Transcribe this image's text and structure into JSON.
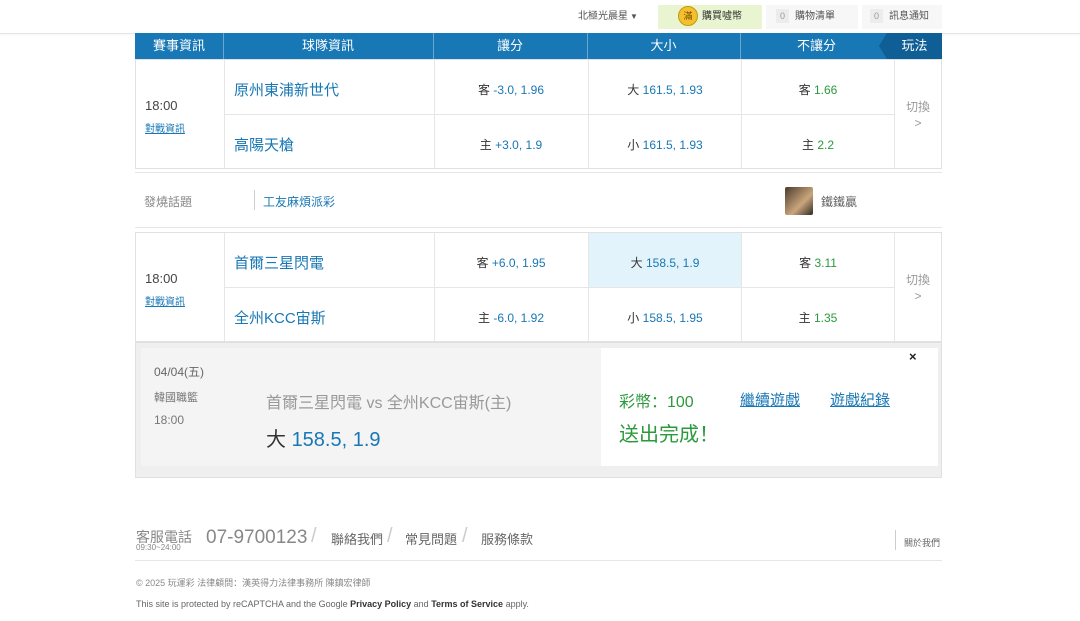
{
  "topbar": {
    "user": "北極光晨星",
    "buy_coin_icon": "滿",
    "buy_label": "購買噓幣",
    "cart_count": "0",
    "cart_label": "購物清單",
    "notify_count": "0",
    "notify_label": "訊息通知"
  },
  "table_header": {
    "col_info": "賽事資訊",
    "col_team": "球隊資訊",
    "col_spread": "讓分",
    "col_total": "大小",
    "col_moneyline": "不讓分",
    "col_play": "玩法"
  },
  "games": [
    {
      "time": "18:00",
      "vs_link": "對戰資訊",
      "away_team": "原州東浦新世代",
      "home_team": "高陽天槍",
      "spread_away_prefix": "客",
      "spread_away_value": "-3.0, 1.96",
      "spread_home_prefix": "主",
      "spread_home_value": "+3.0, 1.9",
      "total_over_prefix": "大",
      "total_over_value": "161.5, 1.93",
      "total_under_prefix": "小",
      "total_under_value": "161.5, 1.93",
      "ml_away_prefix": "客",
      "ml_away_value": "1.66",
      "ml_home_prefix": "主",
      "ml_home_value": "2.2",
      "switch_label": "切換",
      "switch_arrow": ">"
    },
    {
      "time": "18:00",
      "vs_link": "對戰資訊",
      "away_team": "首爾三星閃電",
      "home_team": "全州KCC宙斯",
      "spread_away_prefix": "客",
      "spread_away_value": "+6.0, 1.95",
      "spread_home_prefix": "主",
      "spread_home_value": "-6.0, 1.92",
      "total_over_prefix": "大",
      "total_over_value": "158.5, 1.9",
      "total_under_prefix": "小",
      "total_under_value": "158.5, 1.95",
      "ml_away_prefix": "客",
      "ml_away_value": "3.11",
      "ml_home_prefix": "主",
      "ml_home_value": "1.35",
      "switch_label": "切換",
      "switch_arrow": ">"
    }
  ],
  "topic": {
    "label": "發燒話題",
    "text": "工友麻煩派彩",
    "user": "鐵鐵贏"
  },
  "result": {
    "date": "04/04(五)",
    "league": "韓國職籃",
    "time": "18:00",
    "match": "首爾三星閃電 vs 全州KCC宙斯(主)",
    "bet_prefix": "大",
    "bet_value": "158.5, 1.9",
    "coin_text": "彩幣：100",
    "done_text": "送出完成！",
    "continue_link": "繼續遊戲",
    "record_link": "遊戲紀錄",
    "close": "×"
  },
  "footer": {
    "phone_label": "客服電話",
    "phone_hours": "09:30~24:00",
    "phone_number": "07-9700123",
    "link_contact": "聯絡我們",
    "link_faq": "常見問題",
    "link_terms": "服務條款",
    "link_about": "關於我們",
    "copyright": "© 2025 玩運彩 法律顧問：漢英得力法律事務所 陳鎮宏律師",
    "recaptcha_pre": "This site is protected by reCAPTCHA and the Google ",
    "privacy": "Privacy Policy",
    "recaptcha_and": " and ",
    "tos": "Terms of Service",
    "recaptcha_post": " apply."
  }
}
